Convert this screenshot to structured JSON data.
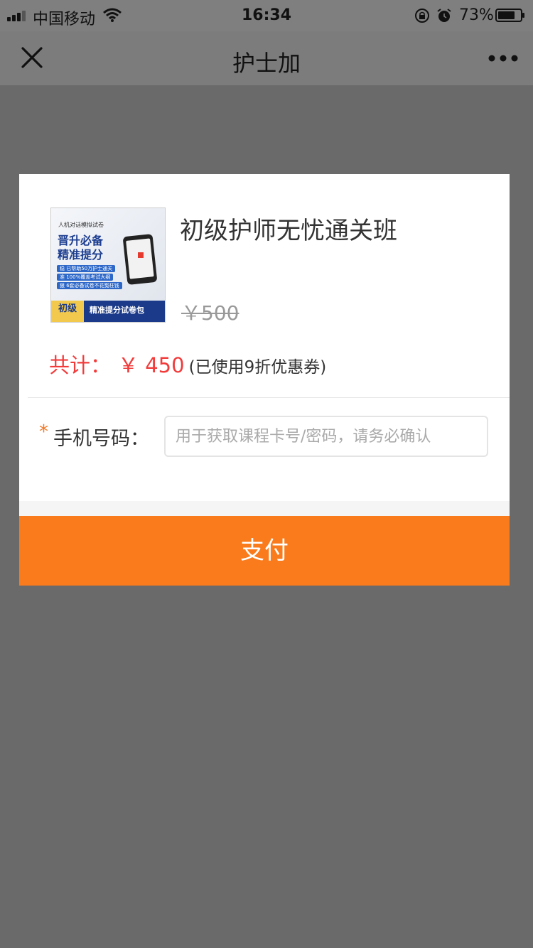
{
  "status_bar": {
    "carrier": "中国移动",
    "time": "16:34",
    "battery_percent": "73%"
  },
  "nav": {
    "title": "护士加"
  },
  "product": {
    "title": "初级护师无忧通关班",
    "original_price": "￥500",
    "thumbnail": {
      "tag_top": "人机对话模拟试卷",
      "headline_1": "晋升必备",
      "headline_2": "精准提分",
      "pills": [
        "稳 已帮助50万护士通关",
        "准 100%覆盖考试大纲",
        "狠 6套必备试卷不花冤枉钱"
      ],
      "level": "初级",
      "bottom_text": "精准提分试卷包"
    }
  },
  "summary": {
    "total_label": "共计：",
    "total_amount": "￥ 450",
    "coupon_note": "(已使用9折优惠券)"
  },
  "form": {
    "required_mark": "*",
    "phone_label": "手机号码：",
    "phone_placeholder": "用于获取课程卡号/密码，请务必确认",
    "phone_value": ""
  },
  "actions": {
    "pay_label": "支付"
  },
  "colors": {
    "overlay": "#6a6a6a",
    "accent_orange": "#f97b1c",
    "price_red": "#f23b3b"
  }
}
